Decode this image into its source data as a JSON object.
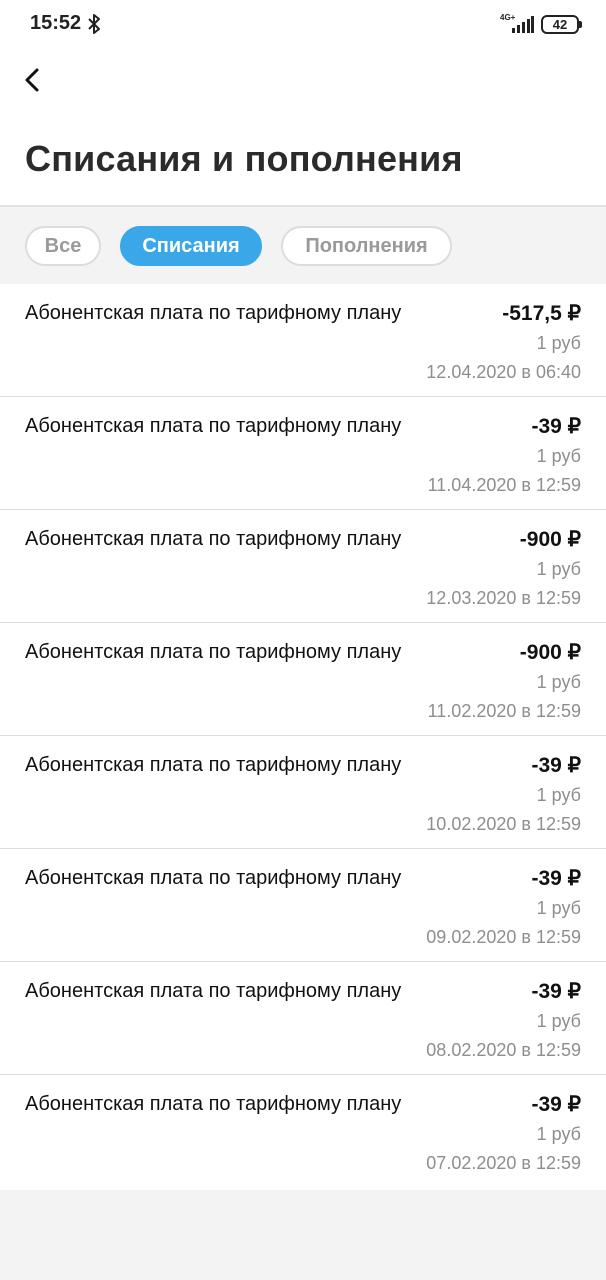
{
  "status_bar": {
    "time": "15:52",
    "network": "4G+",
    "battery": "42"
  },
  "header": {
    "title": "Списания и пополнения"
  },
  "filters": [
    {
      "label": "Все",
      "active": false
    },
    {
      "label": "Списания",
      "active": true
    },
    {
      "label": "Пополнения",
      "active": false
    }
  ],
  "transactions": [
    {
      "title": "Абонентская плата по тарифному плану",
      "amount": "-517,5 ₽",
      "unit": "1 руб",
      "date": "12.04.2020 в 06:40"
    },
    {
      "title": "Абонентская плата по тарифному плану",
      "amount": "-39 ₽",
      "unit": "1 руб",
      "date": "11.04.2020 в 12:59"
    },
    {
      "title": "Абонентская плата по тарифному плану",
      "amount": "-900 ₽",
      "unit": "1 руб",
      "date": "12.03.2020 в 12:59"
    },
    {
      "title": "Абонентская плата по тарифному плану",
      "amount": "-900 ₽",
      "unit": "1 руб",
      "date": "11.02.2020 в 12:59"
    },
    {
      "title": "Абонентская плата по тарифному плану",
      "amount": "-39 ₽",
      "unit": "1 руб",
      "date": "10.02.2020 в 12:59"
    },
    {
      "title": "Абонентская плата по тарифному плану",
      "amount": "-39 ₽",
      "unit": "1 руб",
      "date": "09.02.2020 в 12:59"
    },
    {
      "title": "Абонентская плата по тарифному плану",
      "amount": "-39 ₽",
      "unit": "1 руб",
      "date": "08.02.2020 в 12:59"
    },
    {
      "title": "Абонентская плата по тарифному плану",
      "amount": "-39 ₽",
      "unit": "1 руб",
      "date": "07.02.2020 в 12:59"
    }
  ],
  "icons": {
    "back": "chevron-left-icon",
    "bluetooth": "bluetooth-icon",
    "signal": "signal-icon",
    "battery": "battery-icon"
  },
  "colors": {
    "accent": "#3aa8e8",
    "background": "#f3f3f3",
    "muted_text": "#8e8e8e"
  }
}
